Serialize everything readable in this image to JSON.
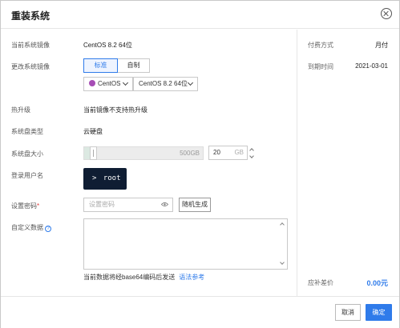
{
  "dialog": {
    "title": "重装系统"
  },
  "form": {
    "current_image_label": "当前系统镜像",
    "current_image_value": "CentOS 8.2 64位",
    "change_image_label": "更改系统镜像",
    "image_tabs": [
      {
        "label": "标准",
        "active": true
      },
      {
        "label": "自制",
        "active": false
      }
    ],
    "os_select": "CentOS",
    "version_select": "CentOS 8.2 64位",
    "hot_upgrade_label": "热升级",
    "hot_upgrade_value": "当前镜像不支持热升级",
    "disk_type_label": "系统盘类型",
    "disk_type_value": "云硬盘",
    "disk_size_label": "系统盘大小",
    "disk_size_max": "500GB",
    "disk_size_value": "20",
    "disk_size_unit": "GB",
    "login_user_label": "登录用户名",
    "login_user_value": "root",
    "login_user_prompt": ">",
    "password_label": "设置密码",
    "password_required_mark": "*",
    "password_placeholder": "设置密码",
    "random_button": "随机生成",
    "userdata_label": "自定义数据",
    "userdata_hint": "当前数据将经base64编码后发送",
    "userdata_link": "语法参考"
  },
  "side": {
    "billing_label": "付费方式",
    "billing_value": "月付",
    "expire_label": "到期时间",
    "expire_value": "2021-03-01",
    "diff_label": "应补差价",
    "diff_value": "0.00元"
  },
  "footer": {
    "cancel": "取消",
    "ok": "确定"
  },
  "colors": {
    "accent": "#2f7bea",
    "terminal_bg": "#0f1d33",
    "required": "#e23b3b"
  }
}
